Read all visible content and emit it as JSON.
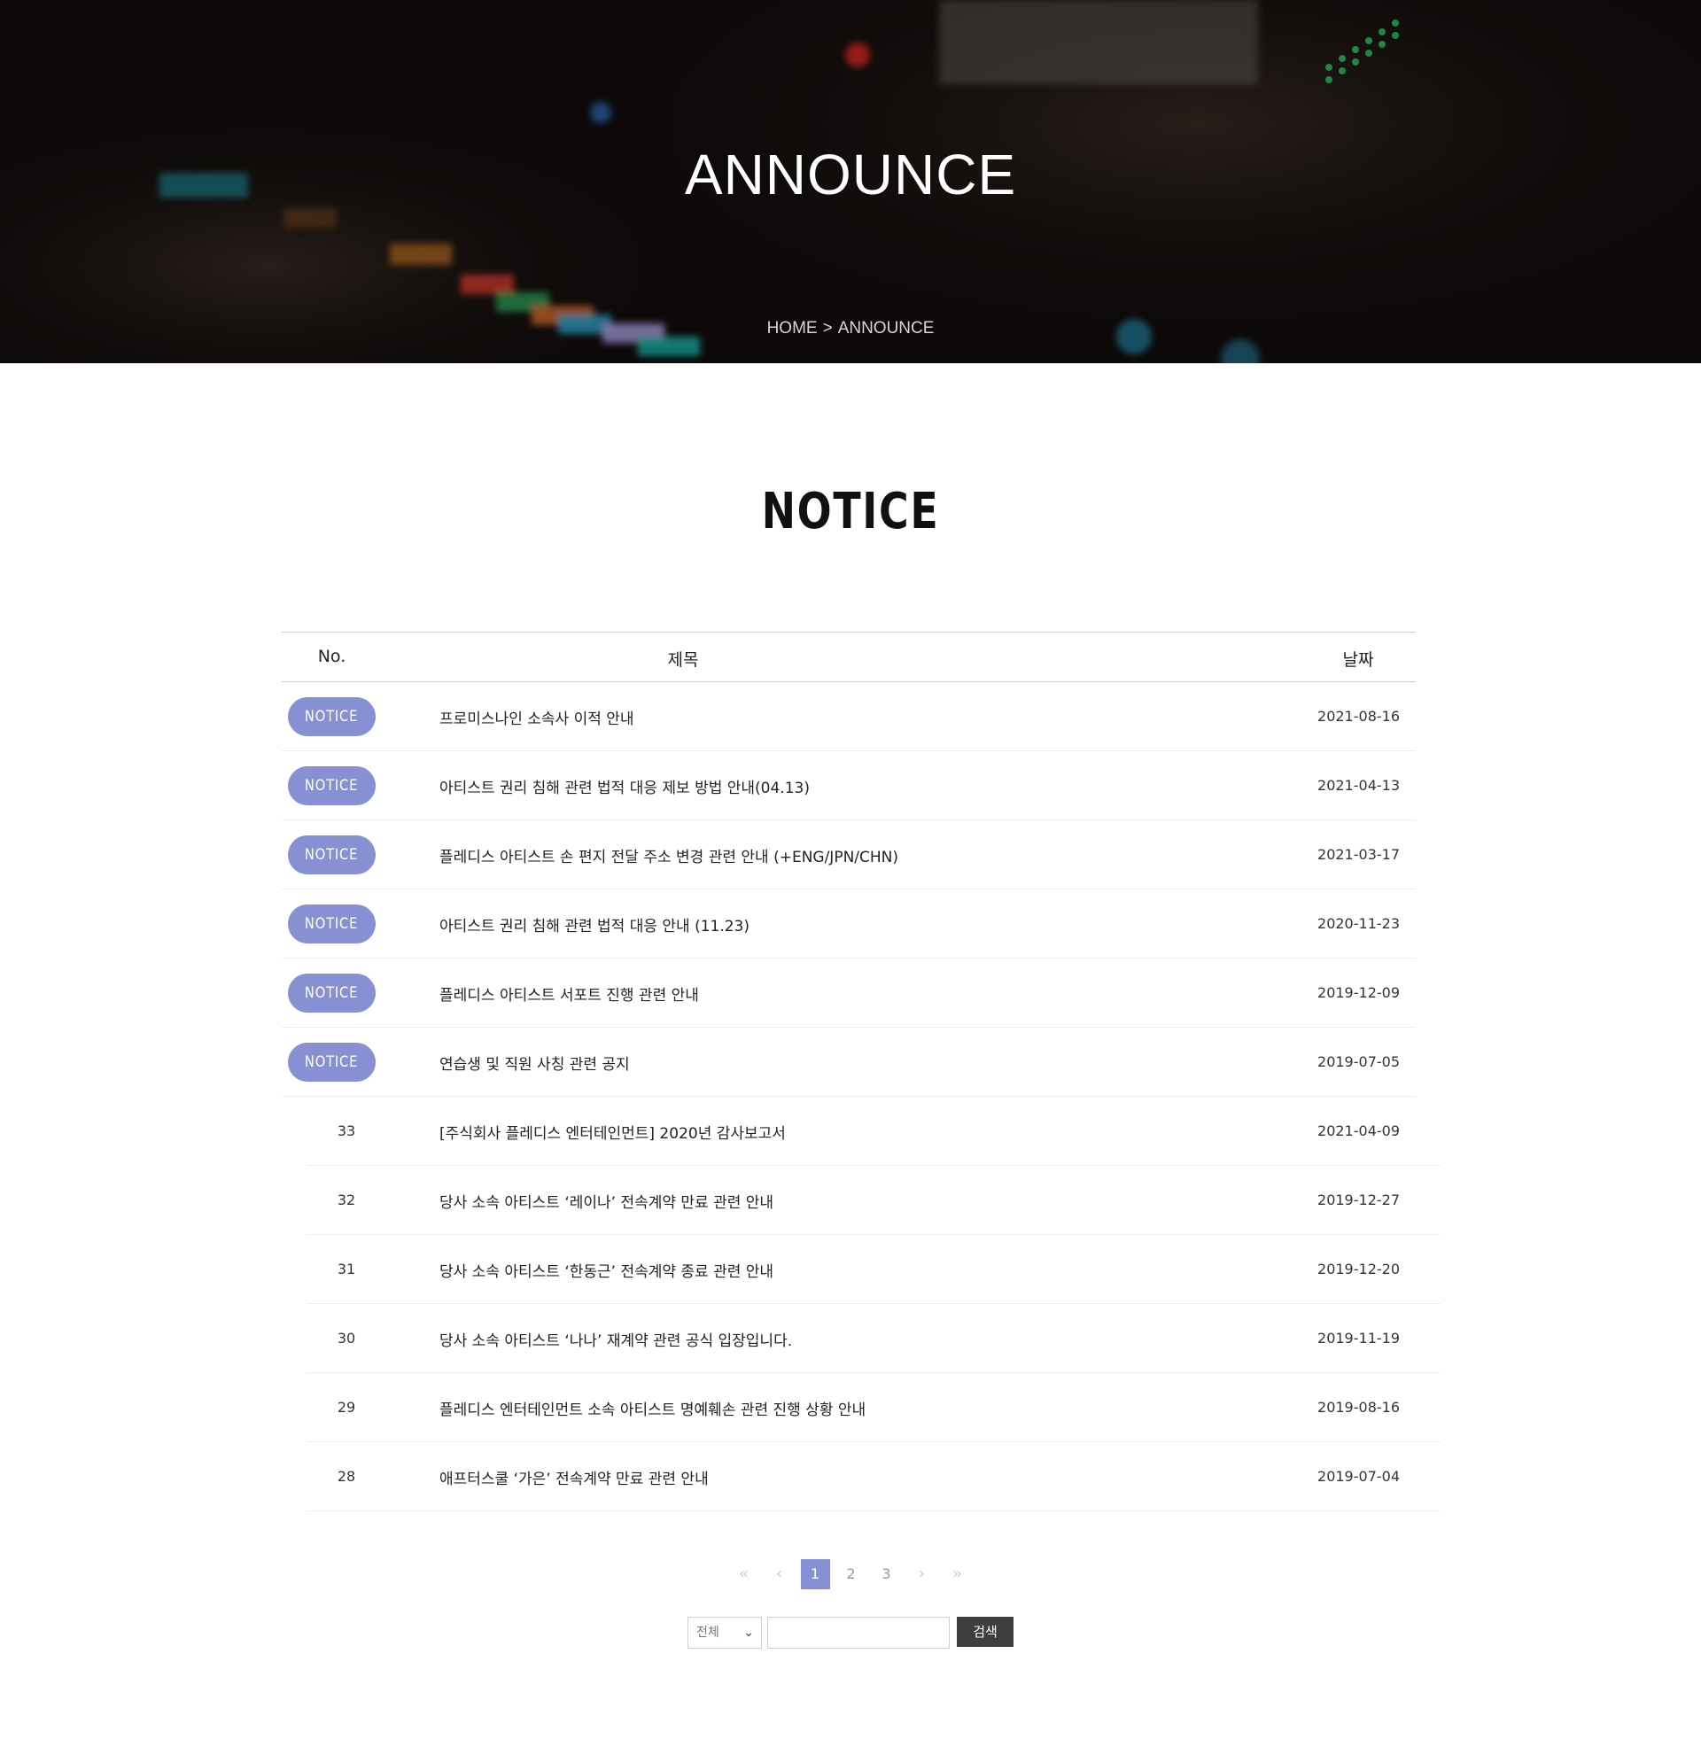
{
  "hero": {
    "title": "ANNOUNCE",
    "breadcrumb": {
      "home": "HOME",
      "separator": ">",
      "current": "ANNOUNCE"
    }
  },
  "section": {
    "title": "NOTICE"
  },
  "table": {
    "headers": {
      "no": "No.",
      "title": "제목",
      "date": "날짜"
    },
    "notices": [
      {
        "badge": "NOTICE",
        "title": "프로미스나인 소속사 이적 안내",
        "date": "2021-08-16"
      },
      {
        "badge": "NOTICE",
        "title": "아티스트 권리 침해 관련 법적 대응 제보 방법 안내(04.13)",
        "date": "2021-04-13"
      },
      {
        "badge": "NOTICE",
        "title": "플레디스 아티스트 손 편지 전달 주소 변경 관련 안내 (+ENG/JPN/CHN)",
        "date": "2021-03-17"
      },
      {
        "badge": "NOTICE",
        "title": "아티스트 권리 침해 관련 법적 대응 안내 (11.23)",
        "date": "2020-11-23"
      },
      {
        "badge": "NOTICE",
        "title": "플레디스 아티스트 서포트 진행 관련 안내",
        "date": "2019-12-09"
      },
      {
        "badge": "NOTICE",
        "title": "연습생 및 직원 사칭 관련 공지",
        "date": "2019-07-05"
      }
    ],
    "posts": [
      {
        "no": "33",
        "title": "[주식회사 플레디스 엔터테인먼트] 2020년 감사보고서",
        "date": "2021-04-09"
      },
      {
        "no": "32",
        "title": "당사 소속 아티스트 ‘레이나’ 전속계약 만료 관련 안내",
        "date": "2019-12-27"
      },
      {
        "no": "31",
        "title": "당사 소속 아티스트 ‘한동근’ 전속계약 종료 관련 안내",
        "date": "2019-12-20"
      },
      {
        "no": "30",
        "title": "당사 소속 아티스트 ‘나나’ 재계약 관련 공식 입장입니다.",
        "date": "2019-11-19"
      },
      {
        "no": "29",
        "title": "플레디스 엔터테인먼트 소속 아티스트 명예훼손 관련 진행 상황 안내",
        "date": "2019-08-16"
      },
      {
        "no": "28",
        "title": "애프터스쿨 ‘가은’ 전속계약 만료 관련 안내",
        "date": "2019-07-04"
      }
    ]
  },
  "pagination": {
    "first": "«",
    "prev": "‹",
    "pages": [
      "1",
      "2",
      "3"
    ],
    "current": "1",
    "next": "›",
    "last": "»"
  },
  "search": {
    "select_value": "전체",
    "input_value": "",
    "button_label": "검색"
  },
  "colors": {
    "accent": "#8790d2",
    "button": "#3e3e3e"
  }
}
